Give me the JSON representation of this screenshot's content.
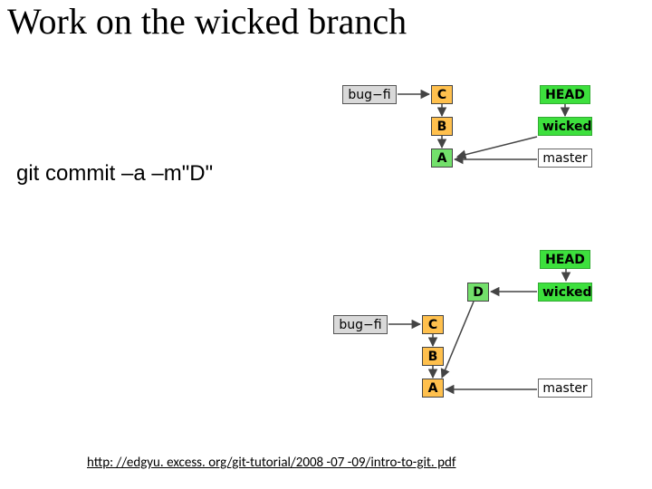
{
  "title": "Work on the wicked branch",
  "command": "git commit –a –m\"D\"",
  "cite": "http: //edgyu. excess. org/git-tutorial/2008 -07 -09/intro-to-git. pdf",
  "diagram_before": {
    "bugfi": "bug−fi",
    "cC": "C",
    "cB": "B",
    "cA": "A",
    "head": "HEAD",
    "wicked": "wicked",
    "master": "master"
  },
  "diagram_after": {
    "bugfi": "bug−fi",
    "cC": "C",
    "cB": "B",
    "cA": "A",
    "cD": "D",
    "head": "HEAD",
    "wicked": "wicked",
    "master": "master"
  }
}
